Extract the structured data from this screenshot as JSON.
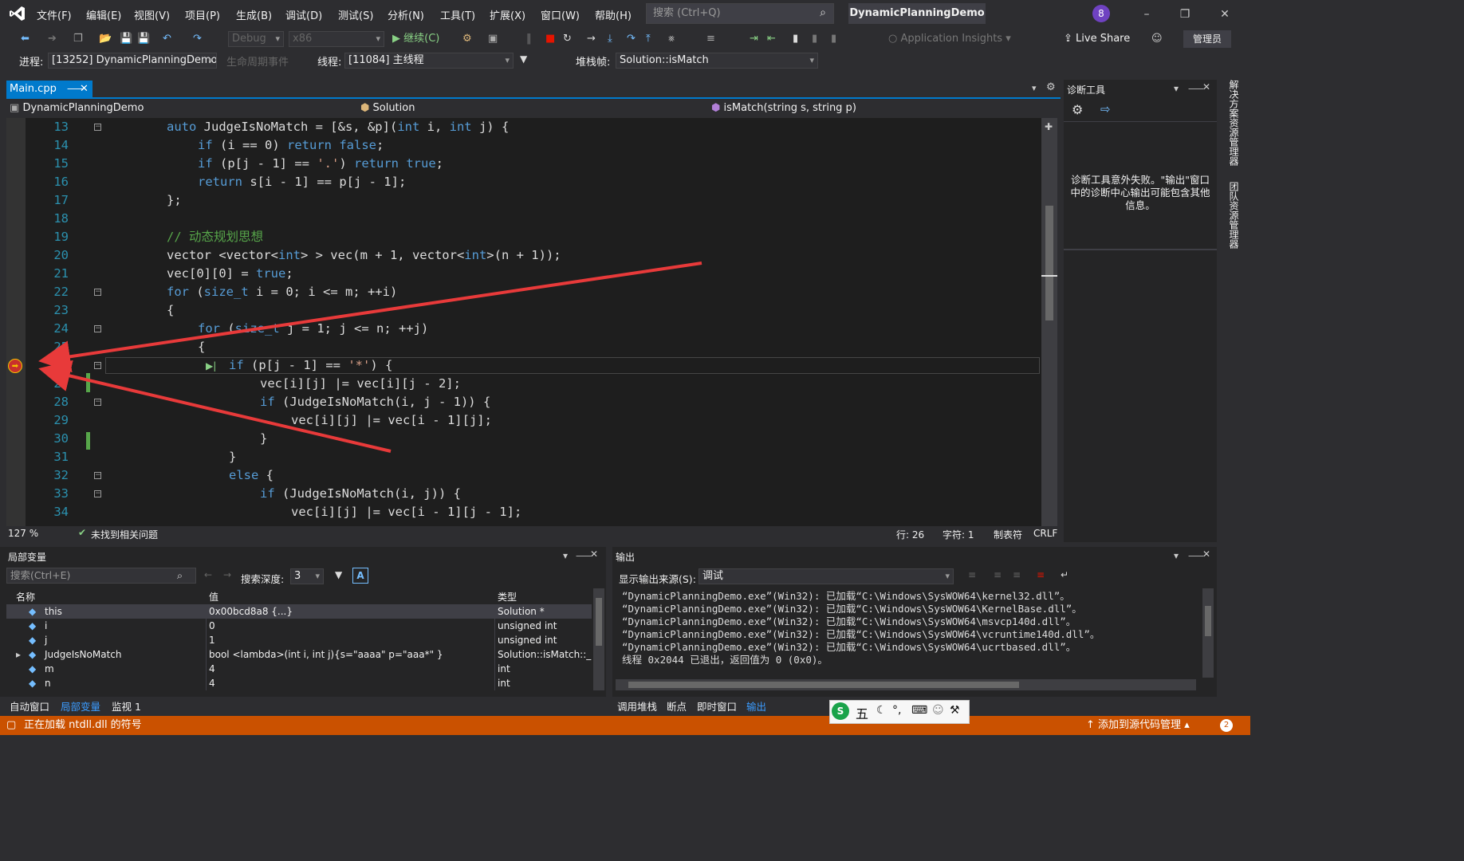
{
  "menubar": {
    "menus": [
      "文件(F)",
      "编辑(E)",
      "视图(V)",
      "项目(P)",
      "生成(B)",
      "调试(D)",
      "测试(S)",
      "分析(N)",
      "工具(T)",
      "扩展(X)",
      "窗口(W)",
      "帮助(H)"
    ],
    "search_placeholder": "搜索 (Ctrl+Q)",
    "solution_title": "DynamicPlanningDemo",
    "notification_count": "8"
  },
  "toolbar": {
    "config": "Debug",
    "platform": "x86",
    "continue_label": "继续(C)",
    "app_insights": "Application Insights",
    "live_share": "Live Share",
    "admin": "管理员"
  },
  "debug_location": {
    "process_label": "进程:",
    "process": "[13252] DynamicPlanningDemo",
    "lifecycle": "生命周期事件",
    "thread_label": "线程:",
    "thread": "[11084] 主线程",
    "stack_label": "堆栈帧:",
    "stack": "Solution::isMatch"
  },
  "editor": {
    "tab": "Main.cpp",
    "nav_project": "DynamicPlanningDemo",
    "nav_class": "Solution",
    "nav_member": "isMatch(string s, string p)",
    "lines": [
      {
        "n": "13",
        "indent": 0,
        "segs": [
          [
            "kw",
            "auto "
          ],
          [
            "",
            "JudgeIsNoMatch = [&s, &p]("
          ],
          [
            "kw",
            "int"
          ],
          [
            "",
            " i, "
          ],
          [
            "kw",
            "int"
          ],
          [
            "",
            " j) {"
          ]
        ]
      },
      {
        "n": "14",
        "indent": 1,
        "segs": [
          [
            "kw",
            "if"
          ],
          [
            "",
            " (i == 0) "
          ],
          [
            "kw",
            "return false"
          ],
          [
            "",
            ";"
          ]
        ]
      },
      {
        "n": "15",
        "indent": 1,
        "segs": [
          [
            "kw",
            "if"
          ],
          [
            "",
            " (p[j - 1] == "
          ],
          [
            "st",
            "'.'"
          ],
          [
            "",
            ") "
          ],
          [
            "kw",
            "return true"
          ],
          [
            "",
            ";"
          ]
        ]
      },
      {
        "n": "16",
        "indent": 1,
        "segs": [
          [
            "kw",
            "return"
          ],
          [
            "",
            " s[i - 1] == p[j - 1];"
          ]
        ]
      },
      {
        "n": "17",
        "indent": 0,
        "segs": [
          [
            "",
            "};"
          ]
        ]
      },
      {
        "n": "18",
        "indent": 0,
        "segs": []
      },
      {
        "n": "19",
        "indent": 0,
        "segs": [
          [
            "cm",
            "// 动态规划思想"
          ]
        ]
      },
      {
        "n": "20",
        "indent": 0,
        "segs": [
          [
            "",
            "vector <vector<"
          ],
          [
            "kw",
            "int"
          ],
          [
            "",
            "> > vec(m + 1, vector<"
          ],
          [
            "kw",
            "int"
          ],
          [
            "",
            ">(n + 1));"
          ]
        ]
      },
      {
        "n": "21",
        "indent": 0,
        "segs": [
          [
            "",
            "vec[0][0] = "
          ],
          [
            "kw",
            "true"
          ],
          [
            "",
            ";"
          ]
        ]
      },
      {
        "n": "22",
        "indent": 0,
        "segs": [
          [
            "kw",
            "for"
          ],
          [
            "",
            " ("
          ],
          [
            "kw",
            "size_t"
          ],
          [
            "",
            " i = 0; i <= m; ++i)"
          ]
        ]
      },
      {
        "n": "23",
        "indent": 0,
        "segs": [
          [
            "",
            "{"
          ]
        ]
      },
      {
        "n": "24",
        "indent": 1,
        "segs": [
          [
            "kw",
            "for"
          ],
          [
            "",
            " ("
          ],
          [
            "kw",
            "size_t"
          ],
          [
            "",
            " j = 1; j <= n; ++j)"
          ]
        ]
      },
      {
        "n": "25",
        "indent": 1,
        "segs": [
          [
            "",
            "{"
          ]
        ]
      },
      {
        "n": "26",
        "indent": 2,
        "segs": [
          [
            "kw",
            "if"
          ],
          [
            "",
            " (p[j - 1] == "
          ],
          [
            "st",
            "'*'"
          ],
          [
            "",
            ") {"
          ]
        ]
      },
      {
        "n": "27",
        "indent": 3,
        "segs": [
          [
            "",
            "vec[i][j] |= vec[i][j - 2];"
          ]
        ]
      },
      {
        "n": "28",
        "indent": 3,
        "segs": [
          [
            "kw",
            "if"
          ],
          [
            "",
            " (JudgeIsNoMatch(i, j - 1)) {"
          ]
        ]
      },
      {
        "n": "29",
        "indent": 4,
        "segs": [
          [
            "",
            "vec[i][j] |= vec[i - 1][j];"
          ]
        ]
      },
      {
        "n": "30",
        "indent": 3,
        "segs": [
          [
            "",
            "}"
          ]
        ]
      },
      {
        "n": "31",
        "indent": 2,
        "segs": [
          [
            "",
            "}"
          ]
        ]
      },
      {
        "n": "32",
        "indent": 2,
        "segs": [
          [
            "kw",
            "else"
          ],
          [
            "",
            " {"
          ]
        ]
      },
      {
        "n": "33",
        "indent": 3,
        "segs": [
          [
            "kw",
            "if"
          ],
          [
            "",
            " (JudgeIsNoMatch(i, j)) {"
          ]
        ]
      },
      {
        "n": "34",
        "indent": 4,
        "segs": [
          [
            "",
            "vec[i][j] |= vec[i - 1][j - 1];"
          ]
        ]
      }
    ],
    "zoom": "127 %",
    "issues": "未找到相关问题",
    "pos_line": "行: 26",
    "pos_char": "字符: 1",
    "tab_mode": "制表符",
    "eol": "CRLF"
  },
  "diagnostics": {
    "title": "诊断工具",
    "message": "诊断工具意外失败。\"输出\"窗口中的诊断中心输出可能包含其他信息。",
    "side_tabs": [
      "解决方案资源管理器",
      "团队资源管理器"
    ]
  },
  "locals": {
    "title": "局部变量",
    "search_placeholder": "搜索(Ctrl+E)",
    "depth_label": "搜索深度:",
    "depth": "3",
    "columns": [
      "名称",
      "值",
      "类型"
    ],
    "rows": [
      {
        "name": "this",
        "value": "0x00bcd8a8 {...}",
        "type": "Solution *",
        "selected": true
      },
      {
        "name": "i",
        "value": "0",
        "type": "unsigned int"
      },
      {
        "name": "j",
        "value": "1",
        "type": "unsigned int"
      },
      {
        "name": "JudgeIsNoMatch",
        "value": "bool <lambda>(int i, int j){s=\"aaaa\" p=\"aaa*\" }",
        "type": "Solution::isMatch::_...",
        "expandable": true
      },
      {
        "name": "m",
        "value": "4",
        "type": "int"
      },
      {
        "name": "n",
        "value": "4",
        "type": "int"
      }
    ],
    "tabs": [
      "自动窗口",
      "局部变量",
      "监视 1"
    ]
  },
  "output": {
    "title": "输出",
    "source_label": "显示输出来源(S):",
    "source": "调试",
    "lines": [
      "“DynamicPlanningDemo.exe”(Win32): 已加载“C:\\Windows\\SysWOW64\\kernel32.dll”。",
      "“DynamicPlanningDemo.exe”(Win32): 已加载“C:\\Windows\\SysWOW64\\KernelBase.dll”。",
      "“DynamicPlanningDemo.exe”(Win32): 已加载“C:\\Windows\\SysWOW64\\msvcp140d.dll”。",
      "“DynamicPlanningDemo.exe”(Win32): 已加载“C:\\Windows\\SysWOW64\\vcruntime140d.dll”。",
      "“DynamicPlanningDemo.exe”(Win32): 已加载“C:\\Windows\\SysWOW64\\ucrtbased.dll”。",
      "线程 0x2044 已退出，返回值为 0 (0x0)。"
    ],
    "tabs": [
      "调用堆栈",
      "断点",
      "即时窗口",
      "输出"
    ]
  },
  "statusbar": {
    "text": "正在加载 ntdll.dll 的符号",
    "source_control": "添加到源代码管理",
    "badge": "2"
  },
  "ime": {
    "mode": "五"
  },
  "colors": {
    "accent": "#007acc",
    "status": "#ca5100",
    "arrow": "#e83a3a"
  }
}
